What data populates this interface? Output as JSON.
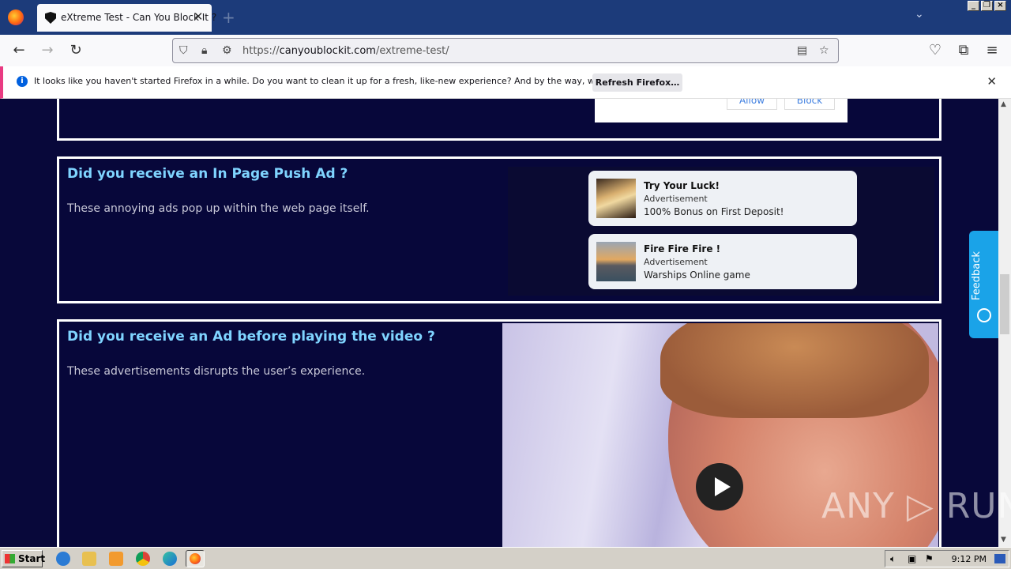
{
  "browser": {
    "tab_title": "eXtreme Test - Can You Block It ?",
    "tab_close": "✕",
    "new_tab": "+",
    "url_prefix": "https://",
    "url_domain": "canyoublockit.com",
    "url_path": "/extreme-test/"
  },
  "notification": {
    "text": "It looks like you haven't started Firefox in a while. Do you want to clean it up for a fresh, like-new experience? And by the way, welcome back!",
    "button_label": "Refresh Firefox…",
    "close": "✕"
  },
  "permission": {
    "allow_label": "Allow",
    "block_label": "Block"
  },
  "sections": {
    "push": {
      "title": "Did you receive an In Page Push Ad ?",
      "description": "These annoying ads pop up within the web page itself."
    },
    "video": {
      "title": "Did you receive an Ad before playing the video ?",
      "description": "These advertisements disrupts the user’s experience."
    }
  },
  "push_ads": [
    {
      "title": "Try Your Luck!",
      "subtitle": "Advertisement",
      "body": "100% Bonus on First Deposit!"
    },
    {
      "title": "Fire Fire Fire !",
      "subtitle": "Advertisement",
      "body": "Warships Online game"
    }
  ],
  "feedback_label": "Feedback",
  "watermark": "ANY ▷ RUN",
  "taskbar": {
    "start_label": "Start",
    "clock": "9:12 PM"
  },
  "colors": {
    "page_bg": "#08083a",
    "heading": "#7fd4ff",
    "feedback": "#1aa3e8"
  }
}
